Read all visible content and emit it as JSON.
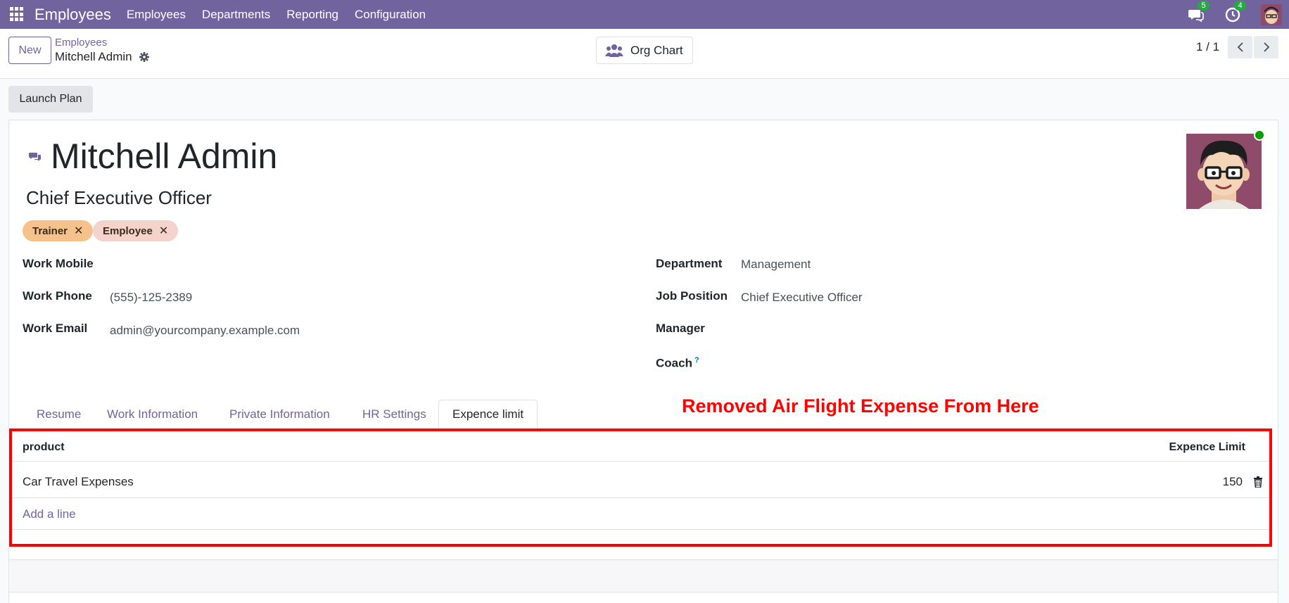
{
  "nav": {
    "brand": "Employees",
    "menu": [
      "Employees",
      "Departments",
      "Reporting",
      "Configuration"
    ],
    "messages_count": "5",
    "activities_count": "4"
  },
  "control": {
    "new_label": "New",
    "breadcrumb_parent": "Employees",
    "breadcrumb_current": "Mitchell Admin",
    "org_chart_label": "Org Chart",
    "pager": "1 / 1"
  },
  "actions": {
    "launch_plan": "Launch Plan"
  },
  "employee": {
    "name": "Mitchell Admin",
    "job_title": "Chief Executive Officer",
    "tags": [
      {
        "label": "Trainer",
        "color": "#f6c28b"
      },
      {
        "label": "Employee",
        "color": "#f4d3cc"
      }
    ]
  },
  "fields_left": [
    {
      "label": "Work Mobile",
      "value": ""
    },
    {
      "label": "Work Phone",
      "value": "(555)-125-2389"
    },
    {
      "label": "Work Email",
      "value": "admin@yourcompany.example.com"
    }
  ],
  "fields_right": [
    {
      "label": "Department",
      "value": "Management"
    },
    {
      "label": "Job Position",
      "value": "Chief Executive Officer"
    },
    {
      "label": "Manager",
      "value": ""
    },
    {
      "label": "Coach",
      "value": "",
      "help": "?"
    }
  ],
  "tabs": [
    "Resume",
    "Work Information",
    "Private Information",
    "HR Settings",
    "Expence limit"
  ],
  "active_tab": "Expence limit",
  "annotation": "Removed Air Flight Expense From Here",
  "expense_table": {
    "columns": [
      "product",
      "Expence Limit"
    ],
    "rows": [
      {
        "product": "Car Travel Expenses",
        "limit": "150"
      }
    ],
    "add_line": "Add a line"
  },
  "colors": {
    "brand": "#71639e",
    "annotation": "#ff0000",
    "online": "#00a000"
  }
}
